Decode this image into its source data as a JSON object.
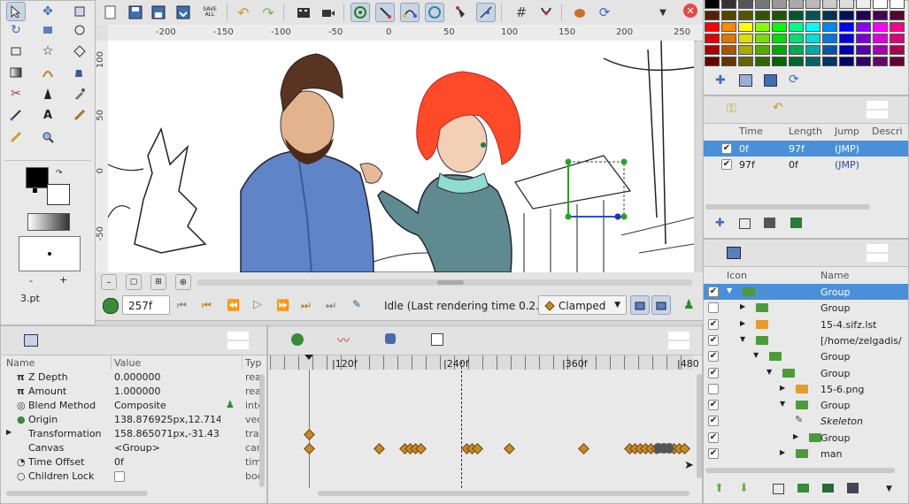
{
  "toolbar": {
    "save_all_label": "SAVE\nALL"
  },
  "ruler_top": [
    "-200",
    "-150",
    "-100",
    "-50",
    "0",
    "50",
    "100",
    "150",
    "200",
    "250"
  ],
  "ruler_left": [
    "100",
    "50",
    "0",
    "-50"
  ],
  "toolbox": {
    "brush_size": "3.pt",
    "minus": "-",
    "plus": "+"
  },
  "transport": {
    "current_time": "257f",
    "status": "Idle (Last rendering time 0.2...",
    "interpolation": "Clamped"
  },
  "params": {
    "col_name": "Name",
    "col_value": "Value",
    "col_type": "Typ",
    "rows": [
      {
        "name": "Z Depth",
        "value": "0.000000",
        "type": "rea"
      },
      {
        "name": "Amount",
        "value": "1.000000",
        "type": "rea"
      },
      {
        "name": "Blend Method",
        "value": "Composite",
        "type": "inte"
      },
      {
        "name": "Origin",
        "value": "138.876925px,12.714575",
        "type": "vect"
      },
      {
        "name": "Transformation",
        "value": "158.865071px,-31.43554​",
        "type": "trar"
      },
      {
        "name": "Canvas",
        "value": "<Group>",
        "type": "can"
      },
      {
        "name": "Time Offset",
        "value": "0f",
        "type": "time"
      },
      {
        "name": "Children Lock",
        "value": "",
        "type": "boo"
      }
    ]
  },
  "timetrack": {
    "ticks": [
      "|120f",
      "|240f",
      "|360f",
      "|480"
    ]
  },
  "keyframes": {
    "col_time": "Time",
    "col_length": "Length",
    "col_jump": "Jump",
    "col_desc": "Descri",
    "rows": [
      {
        "time": "0f",
        "length": "97f",
        "jump": "(JMP)"
      },
      {
        "time": "97f",
        "length": "0f",
        "jump": "(JMP)"
      }
    ]
  },
  "layers": {
    "col_icon": "Icon",
    "col_name": "Name",
    "rows": [
      {
        "name": "Group",
        "checked": true,
        "indent": 0,
        "expander": "down",
        "icon": "folder",
        "selected": true
      },
      {
        "name": "Group",
        "checked": false,
        "indent": 1,
        "expander": "right",
        "icon": "folder",
        "selected": false
      },
      {
        "name": "15-4.sifz.lst",
        "checked": true,
        "indent": 1,
        "expander": "right",
        "icon": "folder-orange",
        "selected": false
      },
      {
        "name": "[/home/zelgadis/",
        "checked": true,
        "indent": 1,
        "expander": "down",
        "icon": "folder",
        "selected": false
      },
      {
        "name": "Group",
        "checked": true,
        "indent": 2,
        "expander": "down",
        "icon": "folder",
        "selected": false
      },
      {
        "name": "Group",
        "checked": true,
        "indent": 3,
        "expander": "down",
        "icon": "folder",
        "selected": false
      },
      {
        "name": "15-6.png",
        "checked": false,
        "indent": 4,
        "expander": "right",
        "icon": "folder-orange",
        "selected": false
      },
      {
        "name": "Group",
        "checked": true,
        "indent": 4,
        "expander": "down",
        "icon": "folder",
        "selected": false
      },
      {
        "name": "Skeleton",
        "checked": true,
        "indent": 5,
        "expander": "",
        "icon": "skeleton",
        "selected": false
      },
      {
        "name": "Group",
        "checked": true,
        "indent": 5,
        "expander": "right",
        "icon": "folder",
        "selected": false
      },
      {
        "name": "man",
        "checked": true,
        "indent": 4,
        "expander": "right",
        "icon": "folder",
        "selected": false
      }
    ]
  },
  "palette": {
    "rows": [
      [
        "#000000",
        "#333333",
        "#555555",
        "#777777",
        "#999999",
        "#aaaaaa",
        "#bbbbbb",
        "#cccccc",
        "#dddddd",
        "#eeeeee",
        "#ffffff",
        "#ffffff"
      ],
      [
        "#552200",
        "#554400",
        "#555500",
        "#335500",
        "#225500",
        "#005533",
        "#005555",
        "#003355",
        "#001155",
        "#220055",
        "#440055",
        "#550033"
      ],
      [
        "#ff0000",
        "#ff8800",
        "#ffff00",
        "#88ff00",
        "#00ff00",
        "#00ff88",
        "#00ffff",
        "#0088ff",
        "#0000ff",
        "#8800ff",
        "#ff00ff",
        "#ff0088"
      ],
      [
        "#dd0000",
        "#dd7700",
        "#dddd00",
        "#77dd00",
        "#00dd00",
        "#00dd77",
        "#00dddd",
        "#0077dd",
        "#0000dd",
        "#7700dd",
        "#dd00dd",
        "#dd0077"
      ],
      [
        "#aa0000",
        "#aa5500",
        "#aaaa00",
        "#55aa00",
        "#00aa00",
        "#00aa55",
        "#00aaaa",
        "#0055aa",
        "#0000aa",
        "#5500aa",
        "#aa00aa",
        "#aa0055"
      ],
      [
        "#660000",
        "#663300",
        "#666600",
        "#336600",
        "#006600",
        "#006633",
        "#006666",
        "#003366",
        "#000066",
        "#330066",
        "#660066",
        "#660033"
      ]
    ]
  },
  "colors": {
    "accent": "#4a90d9",
    "keyframe": "#c98a25"
  }
}
